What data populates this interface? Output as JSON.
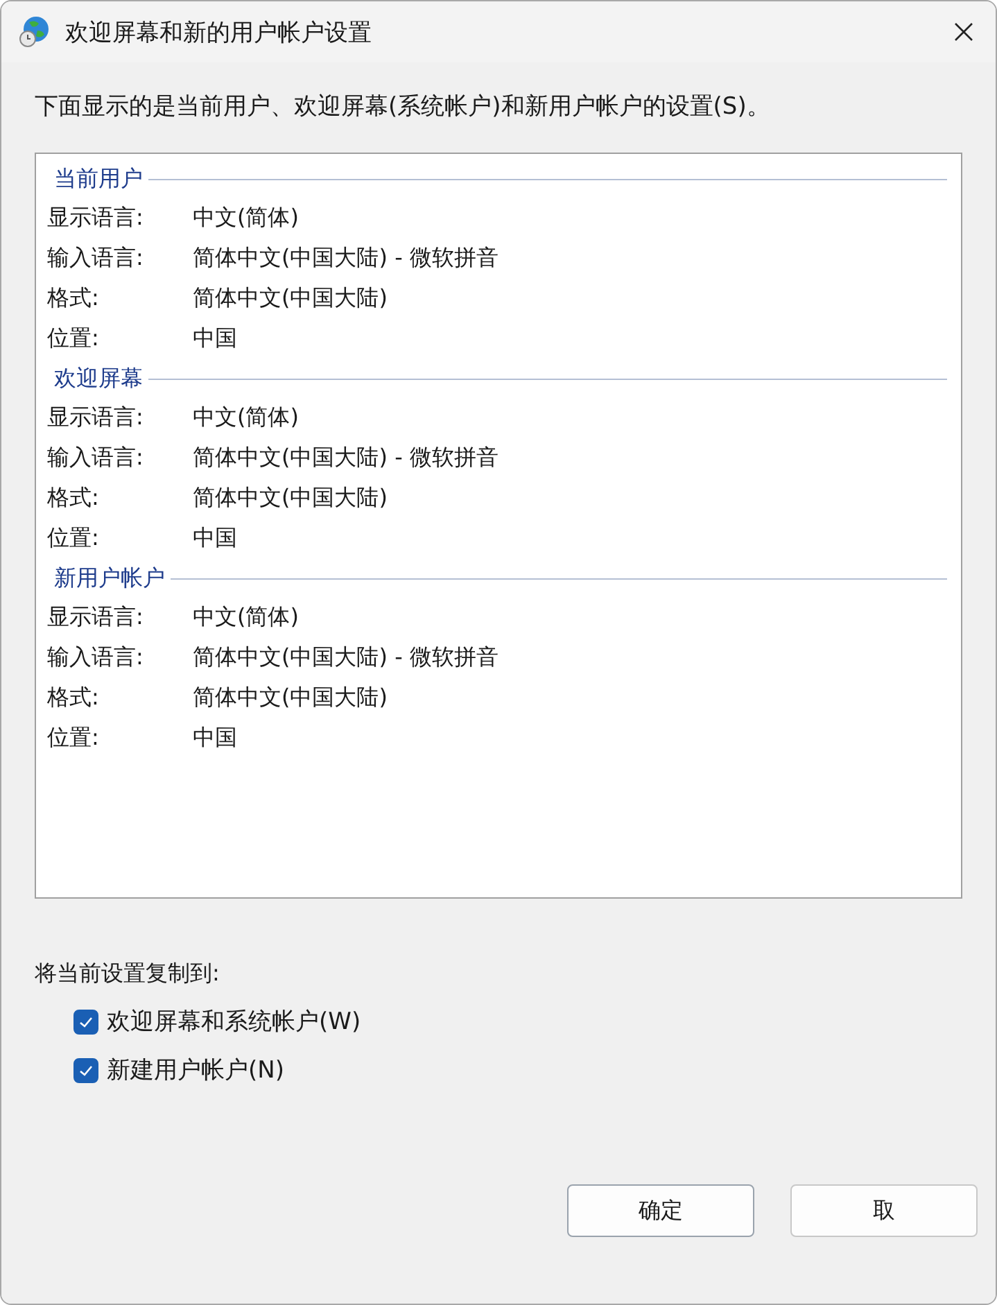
{
  "window": {
    "title": "欢迎屏幕和新的用户帐户设置"
  },
  "description": "下面显示的是当前用户、欢迎屏幕(系统帐户)和新用户帐户的设置(S)。",
  "sections": [
    {
      "heading": "当前用户",
      "rows": [
        {
          "label": "显示语言:",
          "value": "中文(简体)"
        },
        {
          "label": "输入语言:",
          "value": "简体中文(中国大陆) - 微软拼音"
        },
        {
          "label": "格式:",
          "value": "简体中文(中国大陆)"
        },
        {
          "label": "位置:",
          "value": "中国"
        }
      ]
    },
    {
      "heading": "欢迎屏幕",
      "rows": [
        {
          "label": "显示语言:",
          "value": "中文(简体)"
        },
        {
          "label": "输入语言:",
          "value": "简体中文(中国大陆) - 微软拼音"
        },
        {
          "label": "格式:",
          "value": "简体中文(中国大陆)"
        },
        {
          "label": "位置:",
          "value": "中国"
        }
      ]
    },
    {
      "heading": "新用户帐户",
      "rows": [
        {
          "label": "显示语言:",
          "value": "中文(简体)"
        },
        {
          "label": "输入语言:",
          "value": "简体中文(中国大陆) - 微软拼音"
        },
        {
          "label": "格式:",
          "value": "简体中文(中国大陆)"
        },
        {
          "label": "位置:",
          "value": "中国"
        }
      ]
    }
  ],
  "copy_label": "将当前设置复制到:",
  "checkboxes": [
    {
      "label": "欢迎屏幕和系统帐户(W)",
      "checked": true
    },
    {
      "label": "新建用户帐户(N)",
      "checked": true
    }
  ],
  "buttons": [
    {
      "label": "确定",
      "kind": "default"
    },
    {
      "label": "取",
      "kind": "normal"
    }
  ]
}
